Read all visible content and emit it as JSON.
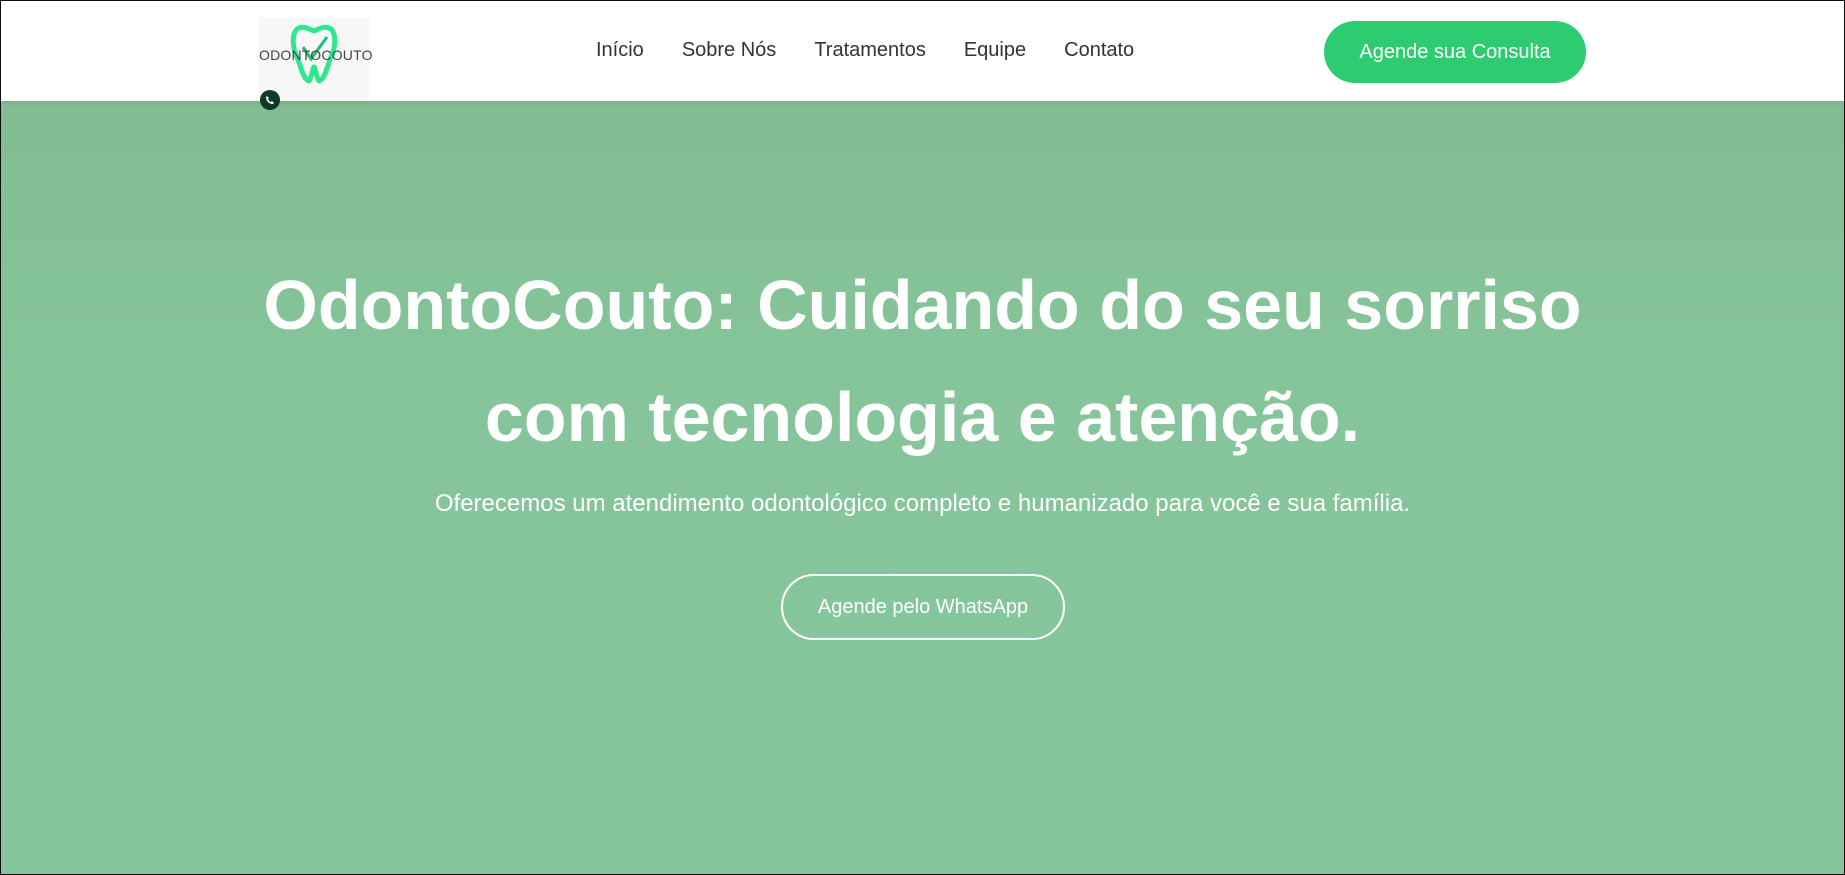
{
  "brand": {
    "logo_text": "ODONTOCOUTO",
    "logo_icon": "tooth-icon",
    "accent_color": "#2ecc71"
  },
  "nav": {
    "items": [
      {
        "label": "Início"
      },
      {
        "label": "Sobre Nós"
      },
      {
        "label": "Tratamentos"
      },
      {
        "label": "Equipe"
      },
      {
        "label": "Contato"
      }
    ],
    "cta_label": "Agende sua Consulta"
  },
  "hero": {
    "title": "OdontoCouto: Cuidando do seu sorriso com tecnologia e atenção.",
    "subtitle": "Oferecemos um atendimento odontológico completo e humanizado para você e sua família.",
    "button_label": "Agende pelo WhatsApp",
    "background_color": "#86c59b"
  }
}
